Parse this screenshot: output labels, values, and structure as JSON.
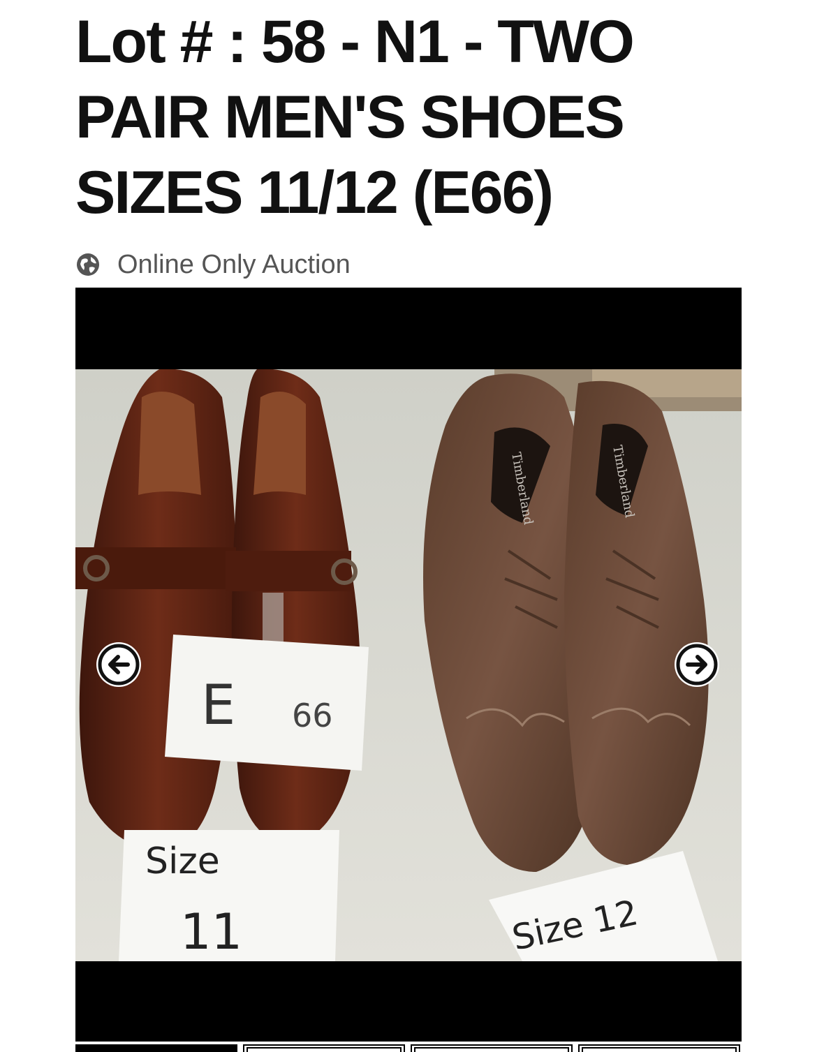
{
  "lot": {
    "title": "Lot # : 58 - N1 - TWO PAIR MEN'S SHOES SIZES 11/12 (E66)"
  },
  "auction": {
    "type_label": "Online Only Auction",
    "icon": "globe-icon"
  },
  "gallery": {
    "photo_labels": {
      "tag_top": "E",
      "tag_number": "66",
      "left_size_word": "Size",
      "left_size_value": "11",
      "right_size": "Size 12",
      "insole_brand": "Timberland"
    },
    "prev_icon": "arrow-left-icon",
    "next_icon": "arrow-right-icon",
    "thumbnail_count": 4,
    "active_thumbnail": 1
  },
  "colors": {
    "title": "#111111",
    "subtitle": "#555555",
    "gallery_background": "#000000",
    "brown_leather": "#5a2414",
    "suede": "#6a4a36"
  }
}
